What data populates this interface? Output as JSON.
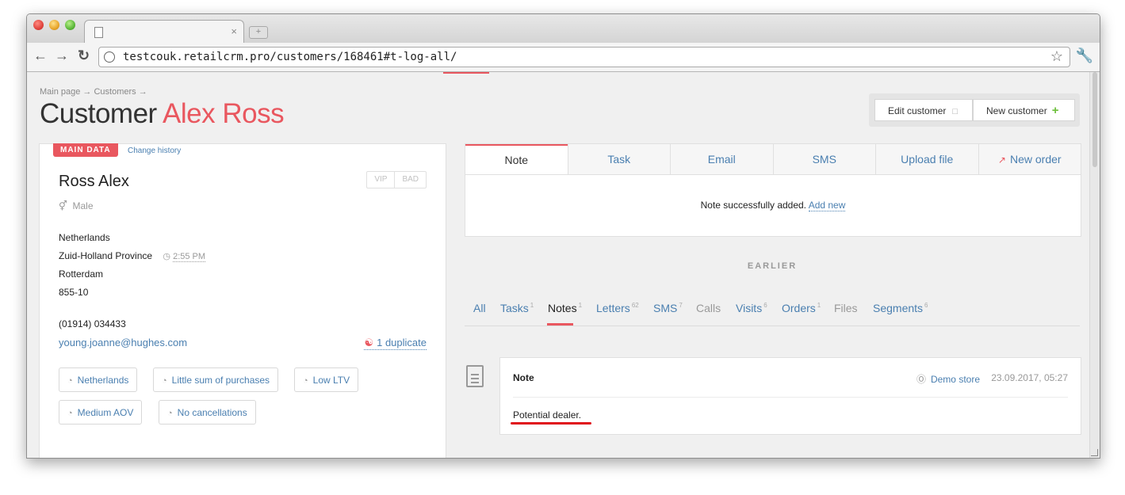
{
  "browser": {
    "url": "testcouk.retailcrm.pro/customers/168461#t-log-all/",
    "tab_close": "×",
    "new_tab": "+"
  },
  "breadcrumb": "Main page → Customers →",
  "page_title": {
    "prefix": "Customer",
    "name": "Alex Ross"
  },
  "actions": {
    "edit": "Edit customer",
    "new": "New customer"
  },
  "customer_card": {
    "badge": "MAIN DATA",
    "change_history": "Change history",
    "name": "Ross Alex",
    "vip": "VIP",
    "bad": "BAD",
    "gender": "Male",
    "country": "Netherlands",
    "region": "Zuid-Holland Province",
    "local_time": "2:55 PM",
    "city": "Rotterdam",
    "postcode": "855-10",
    "phone": "(01914) 034433",
    "email": "young.joanne@hughes.com",
    "duplicate": "1 duplicate",
    "segments": [
      "Netherlands",
      "Little sum of purchases",
      "Low LTV",
      "Medium AOV",
      "No cancellations"
    ]
  },
  "action_tabs": [
    "Note",
    "Task",
    "Email",
    "SMS",
    "Upload file",
    "New order"
  ],
  "note_message": {
    "text": "Note successfully added.",
    "link": "Add new"
  },
  "earlier_label": "EARLIER",
  "filters": [
    {
      "label": "All",
      "count": ""
    },
    {
      "label": "Tasks",
      "count": "1"
    },
    {
      "label": "Notes",
      "count": "1"
    },
    {
      "label": "Letters",
      "count": "62"
    },
    {
      "label": "SMS",
      "count": "7"
    },
    {
      "label": "Calls",
      "count": ""
    },
    {
      "label": "Visits",
      "count": "6"
    },
    {
      "label": "Orders",
      "count": "1"
    },
    {
      "label": "Files",
      "count": ""
    },
    {
      "label": "Segments",
      "count": "6"
    }
  ],
  "note_entry": {
    "title": "Note",
    "store": "Demo store",
    "datetime": "23.09.2017, 05:27",
    "body": "Potential dealer."
  },
  "colors": {
    "accent": "#e9575f",
    "link": "#4a7fb0",
    "add": "#6cbf3a"
  }
}
